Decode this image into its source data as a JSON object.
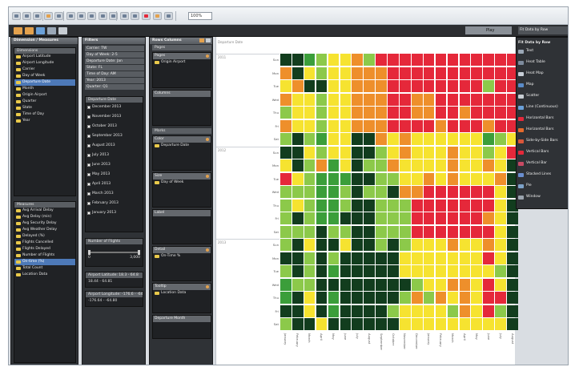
{
  "toolbar": {
    "zoom_value": "100%",
    "icons": [
      "undo-icon",
      "redo-icon",
      "save-icon",
      "new-sheet-icon",
      "connect-data-icon",
      "pause-icon",
      "run-icon",
      "swap-icon",
      "sort-asc-icon",
      "sort-desc-icon",
      "group-icon",
      "label-icon",
      "fit-icon",
      "highlight-icon",
      "presentation-icon"
    ]
  },
  "secondary_toolbar": {
    "icons": [
      "data-icon",
      "analytics-icon",
      "pages-icon",
      "filter-icon",
      "marks-icon"
    ],
    "right_tabs": [
      "Play",
      "Fit Data by Row"
    ]
  },
  "dimensions_panel": {
    "title": "Dimension / Measures",
    "dimensions_header": "Dimensions",
    "dimensions": [
      {
        "label": "Airport Latitude",
        "selected": false
      },
      {
        "label": "Airport Longitude",
        "selected": false
      },
      {
        "label": "Carrier",
        "selected": false
      },
      {
        "label": "Day of Week",
        "selected": false
      },
      {
        "label": "Departure Date",
        "selected": true
      },
      {
        "label": "Month",
        "selected": false
      },
      {
        "label": "Origin Airport",
        "selected": false
      },
      {
        "label": "Quarter",
        "selected": false
      },
      {
        "label": "State",
        "selected": false
      },
      {
        "label": "Time of Day",
        "selected": false
      },
      {
        "label": "Year",
        "selected": false
      }
    ],
    "measures_header": "Measures",
    "measures": [
      {
        "label": "Avg Arrival Delay",
        "selected": false
      },
      {
        "label": "Avg Delay (min)",
        "selected": false
      },
      {
        "label": "Avg Security Delay",
        "selected": false
      },
      {
        "label": "Avg Weather Delay",
        "selected": false
      },
      {
        "label": "Delayed (%)",
        "selected": false
      },
      {
        "label": "Flights Cancelled",
        "selected": false
      },
      {
        "label": "Flights Delayed",
        "selected": false
      },
      {
        "label": "Number of Flights",
        "selected": false
      },
      {
        "label": "On-time (%)",
        "selected": true
      },
      {
        "label": "Total Count",
        "selected": false
      },
      {
        "label": "Location Data",
        "selected": false
      }
    ]
  },
  "filters_panel": {
    "title": "Filters",
    "filters": [
      "Carrier: TW",
      "Day of Week: 2-5",
      "Departure Date: Jan",
      "State: FL",
      "Time of Day: AM",
      "Year: 2013",
      "Quarter: Q1"
    ],
    "date_list_header": "Departure Date",
    "dates": [
      "December 2013",
      "November 2013",
      "October 2013",
      "September 2013",
      "August 2013",
      "July 2013",
      "June 2013",
      "May 2013",
      "April 2013",
      "March 2013",
      "February 2013",
      "January 2013"
    ],
    "flights_header": "Number of Flights",
    "flights_min": "0",
    "flights_max": "3,000",
    "lat_header": "Airport Latitude: 18.3 - 64.8",
    "lat_value": "18.44 - 64.81",
    "lon_header": "Airport Longitude: -176.6 - -64.8",
    "lon_value": "-176.64 - -64.80"
  },
  "shelves_panel": {
    "title": "Rows  Columns",
    "pages_label": "Pages",
    "pages_item": "Origin Airport",
    "filters_label": "Columns",
    "marks_label": "Marks",
    "color_label": "Color",
    "color_item": "Departure Date",
    "size_label": "Size",
    "size_item": "Day of Week",
    "label_label": "Label",
    "detail_label": "Detail",
    "detail_item": "On-Time %",
    "tooltip_label": "Tooltip",
    "tooltip_item": "Location Data",
    "legend_label": "Departure Month"
  },
  "viz": {
    "header": "Departure Date",
    "band_labels": [
      "2011",
      "2012",
      "2013"
    ],
    "row_labels": [
      "Sun",
      "Mon",
      "Tue",
      "Wed",
      "Thu",
      "Fri",
      "Sat"
    ],
    "column_labels": [
      "January",
      "February",
      "March",
      "April",
      "May",
      "June",
      "July",
      "August",
      "September",
      "October",
      "November",
      "December",
      "January",
      "February",
      "March",
      "April",
      "May",
      "June",
      "July",
      "August"
    ],
    "colors": {
      "R": "#e5283a",
      "O": "#ee8f2b",
      "Y": "#f6e330",
      "L": "#8cc94a",
      "G": "#3b9e3a",
      "D": "#123d1e"
    },
    "heatmap_rows": [
      "DDGLYYOLRRRRRRRRRRRR",
      "ODYLYYOOORRRRRRRRRRR",
      "YODDYYOOORRRRRRRRLRR",
      "OYYLYYOOORROORRRRRRR",
      "LYYLYYOOORROORRORRRR",
      "OYYLYYOOORRRRORRRORR",
      "LDLGYYDDOYOYYYYYYGLY",
      "DDYLYYDDLYOYYYOYYLYR",
      "YDLOGYDLLOYYYYOYYOYD",
      "RYLGGGDDLLYYOYOYYYOD",
      "LLLGGLDLLDOORRRRRRYD",
      "LYLGGLDDLLLRRRRRRRYD",
      "LDLGGDDDLLLRRRRRROYD",
      "LLLDLLDDLLLRRRRRRRYD",
      "LDYDDYDDLDLYYYOYYOYD",
      "DDLDLDDDDDYYYYYYYRYD",
      "LDLDGDDDDDYYYYYYYYLD",
      "GLLDDDDDDDDLYYOOYRYD",
      "GDYDGDDDDDLOLOYOYRRD",
      "DDYDGDDDDLYYYYLOYRLD",
      "LDDYDDDDDDYYYYYYYYYD"
    ]
  },
  "show_me": {
    "title": "Fit Data by Row",
    "items": [
      {
        "label": "Text",
        "icon": "text-table-icon",
        "color": "#9aa7b6"
      },
      {
        "label": "Heat Table",
        "icon": "heat-table-icon",
        "color": "#7d8b9d"
      },
      {
        "label": "Heat Map",
        "icon": "heat-map-icon",
        "color": "#c8cfd8"
      },
      {
        "label": "Map",
        "icon": "map-icon",
        "color": "#5a8bc8"
      },
      {
        "label": "Scatter",
        "icon": "scatter-icon",
        "color": "#c7cdd3"
      },
      {
        "label": "Line (Continuous)",
        "icon": "line-icon",
        "color": "#6aa0d8"
      },
      {
        "label": "Horizontal Bars",
        "icon": "hbar-icon",
        "color": "#e5283a"
      },
      {
        "label": "Horizontal Bars",
        "icon": "stacked-hbar-icon",
        "color": "#e56a2b"
      },
      {
        "label": "Side-by-Side Bars",
        "icon": "side-bar-icon",
        "color": "#d9563a"
      },
      {
        "label": "Vertical Bars",
        "icon": "vbar-icon",
        "color": "#e5283a"
      },
      {
        "label": "Vertical Bar",
        "icon": "stacked-vbar-icon",
        "color": "#c94a63"
      },
      {
        "label": "Stacked Lines",
        "icon": "stacked-line-icon",
        "color": "#6a8fd0"
      },
      {
        "label": "Pie",
        "icon": "pie-icon",
        "color": "#7da2c8"
      },
      {
        "label": "Window",
        "icon": "window-icon",
        "color": "#9aa3ad"
      }
    ]
  }
}
